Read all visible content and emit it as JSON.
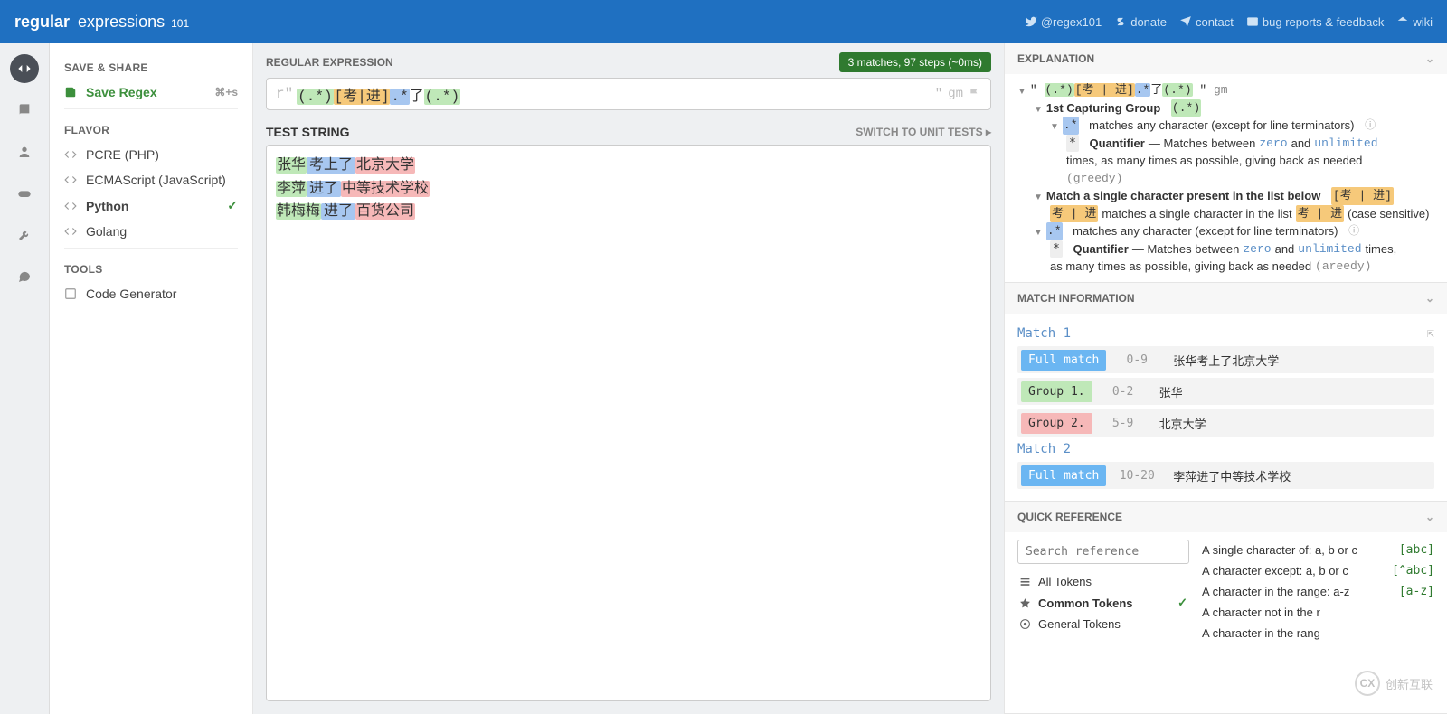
{
  "logo": {
    "prefix": "regular",
    "mid": "expressions",
    "suffix": "101"
  },
  "topnav": {
    "twitter": "@regex101",
    "donate": "donate",
    "contact": "contact",
    "bugs": "bug reports & feedback",
    "wiki": "wiki"
  },
  "sidebar": {
    "save_share": "SAVE & SHARE",
    "save_regex": "Save Regex",
    "save_kbd": "⌘+s",
    "flavor": "FLAVOR",
    "flavors": [
      {
        "label": "PCRE (PHP)",
        "sel": false
      },
      {
        "label": "ECMAScript (JavaScript)",
        "sel": false
      },
      {
        "label": "Python",
        "sel": true
      },
      {
        "label": "Golang",
        "sel": false
      }
    ],
    "tools": "TOOLS",
    "codegen": "Code Generator"
  },
  "main": {
    "regex_label": "REGULAR EXPRESSION",
    "status": "3 matches, 97 steps (~0ms)",
    "prefix": "r\"",
    "suffix": "\"",
    "flags": "gm",
    "regex_parts": {
      "g1": "(.*)",
      "char": "[考|进]",
      "dotstar": ".*",
      "lit": "了",
      "g2": "(.*)"
    },
    "teststring_label": "TEST STRING",
    "switch": "SWITCH TO UNIT TESTS",
    "lines": [
      {
        "g1": "张华",
        "mid": "考上了",
        "g2": "北京大学"
      },
      {
        "g1": "李萍",
        "mid": "进了",
        "g2": "中等技术学校"
      },
      {
        "g1": "韩梅梅",
        "mid": "进了",
        "g2": "百货公司"
      }
    ]
  },
  "explain": {
    "label": "EXPLANATION",
    "full_regex": "(.*)[考|进].*了(.*)",
    "full_suffix": "gm",
    "group1_label": "1st Capturing Group",
    "group1_tok": "(.*)",
    "dotstar_tok": ".*",
    "any_char": "matches any character (except for line terminators)",
    "quant_label": "Quantifier",
    "quant_text1": " — Matches between ",
    "zero": "zero",
    "and": " and ",
    "unlimited": "unlimited",
    "quant_text2": " times, as many times as possible, giving back as needed ",
    "greedy": "(greedy)",
    "charclass_label": "Match a single character present in the list below",
    "charclass_tok": "[考 | 进]",
    "charclass_chars": "考 | 进",
    "charclass_text": " matches a single character in the list ",
    "case": " (case sensitive)",
    "areedy": "(areedy)"
  },
  "match": {
    "label": "MATCH INFORMATION",
    "items": [
      {
        "title": "Match 1",
        "rows": [
          {
            "tag": "Full match",
            "cls": "tag-full",
            "range": "0-9",
            "val": "张华考上了北京大学"
          },
          {
            "tag": "Group 1.",
            "cls": "tag-g1",
            "range": "0-2",
            "val": "张华"
          },
          {
            "tag": "Group 2.",
            "cls": "tag-g2",
            "range": "5-9",
            "val": "北京大学"
          }
        ]
      },
      {
        "title": "Match 2",
        "rows": [
          {
            "tag": "Full match",
            "cls": "tag-full",
            "range": "10-20",
            "val": "李萍进了中等技术学校"
          }
        ]
      }
    ]
  },
  "qr": {
    "label": "QUICK REFERENCE",
    "search_ph": "Search reference",
    "cats": [
      {
        "label": "All Tokens",
        "sel": false
      },
      {
        "label": "Common Tokens",
        "sel": true
      },
      {
        "label": "General Tokens",
        "sel": false
      }
    ],
    "tokens": [
      {
        "desc": "A single character of: a, b or c",
        "code": "[abc]"
      },
      {
        "desc": "A character except: a, b or c",
        "code": "[^abc]"
      },
      {
        "desc": "A character in the range: a-z",
        "code": "[a-z]"
      },
      {
        "desc": "A character not in the r",
        "code": ""
      },
      {
        "desc": "A character in the rang",
        "code": ""
      }
    ]
  },
  "watermark": "创新互联"
}
